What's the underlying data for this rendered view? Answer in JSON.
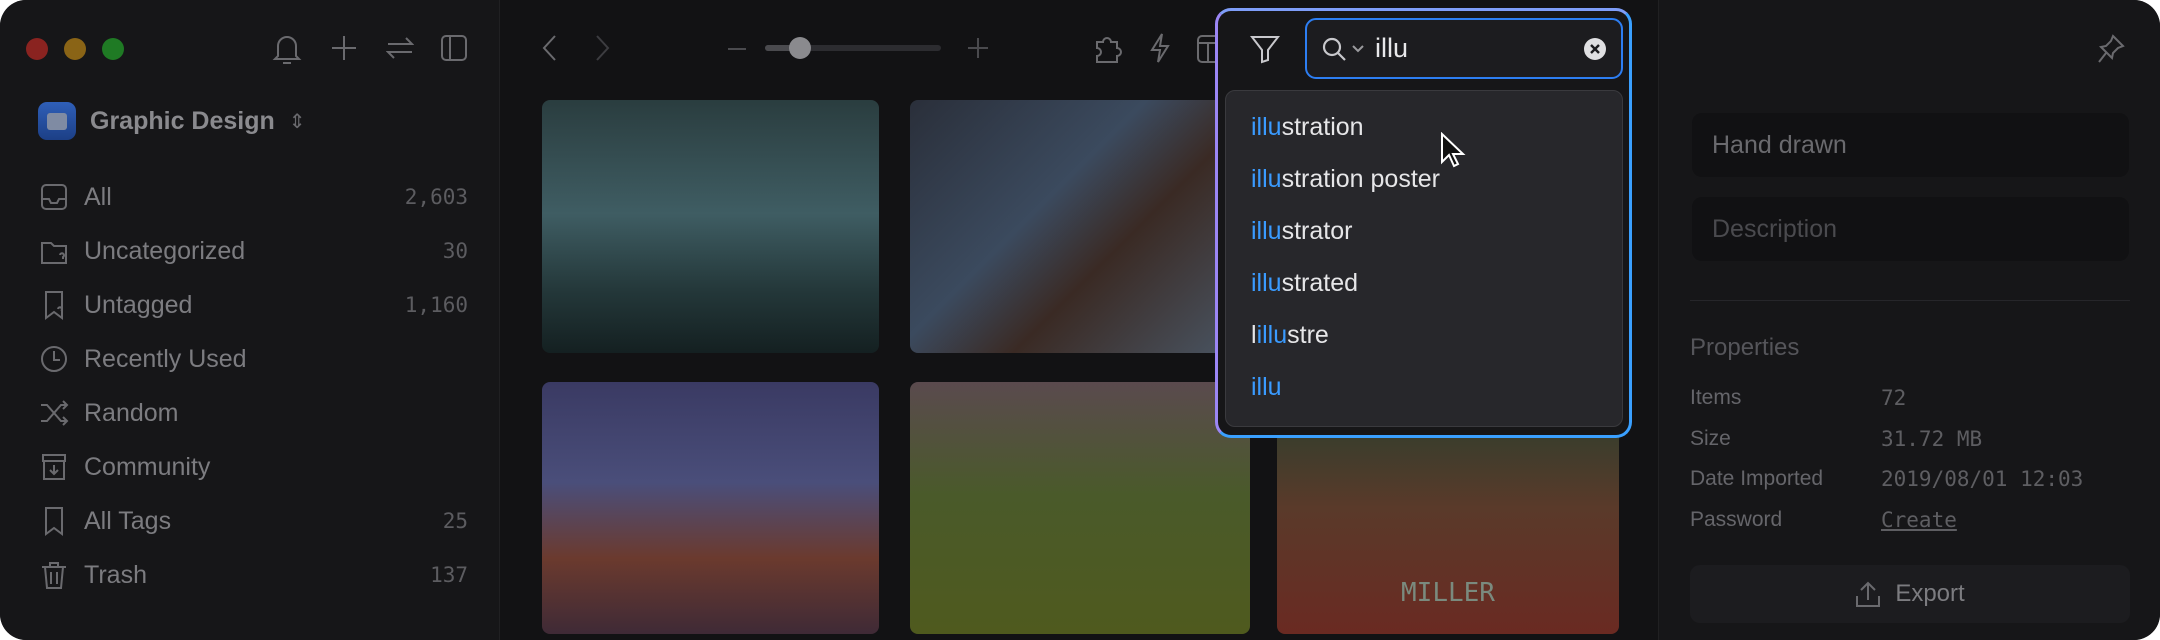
{
  "sidebar": {
    "library": "Graphic Design",
    "items": [
      {
        "label": "All",
        "count": "2,603",
        "icon": "inbox-icon"
      },
      {
        "label": "Uncategorized",
        "count": "30",
        "icon": "folder-question-icon"
      },
      {
        "label": "Untagged",
        "count": "1,160",
        "icon": "tag-question-icon"
      },
      {
        "label": "Recently Used",
        "count": "",
        "icon": "clock-icon"
      },
      {
        "label": "Random",
        "count": "",
        "icon": "shuffle-icon"
      },
      {
        "label": "Community",
        "count": "",
        "icon": "archive-download-icon"
      },
      {
        "label": "All Tags",
        "count": "25",
        "icon": "bookmark-icon"
      },
      {
        "label": "Trash",
        "count": "137",
        "icon": "trash-icon"
      }
    ]
  },
  "toolbar": {
    "zoom_level": 0.2
  },
  "search": {
    "query": "illu",
    "suggestions": [
      {
        "pre": "",
        "match": "illu",
        "post": "stration"
      },
      {
        "pre": "",
        "match": "illu",
        "post": "stration poster"
      },
      {
        "pre": "",
        "match": "illu",
        "post": "strator"
      },
      {
        "pre": "",
        "match": "illu",
        "post": "strated"
      },
      {
        "pre": "l",
        "match": "illu",
        "post": "stre"
      },
      {
        "pre": "",
        "match": "illu",
        "post": ""
      }
    ]
  },
  "thumbnails": {
    "poster_text": "MILLER"
  },
  "inspector": {
    "tags_value": "Hand drawn",
    "description_placeholder": "Description",
    "properties_title": "Properties",
    "properties": [
      {
        "label": "Items",
        "value": "72"
      },
      {
        "label": "Size",
        "value": "31.72 MB"
      },
      {
        "label": "Date Imported",
        "value": "2019/08/01 12:03"
      },
      {
        "label": "Password",
        "value": "Create"
      }
    ],
    "export_label": "Export"
  },
  "colors": {
    "accent": "#3a9bff",
    "highlight_gradient_start": "#9b86f5",
    "highlight_gradient_end": "#3aa0ff"
  }
}
